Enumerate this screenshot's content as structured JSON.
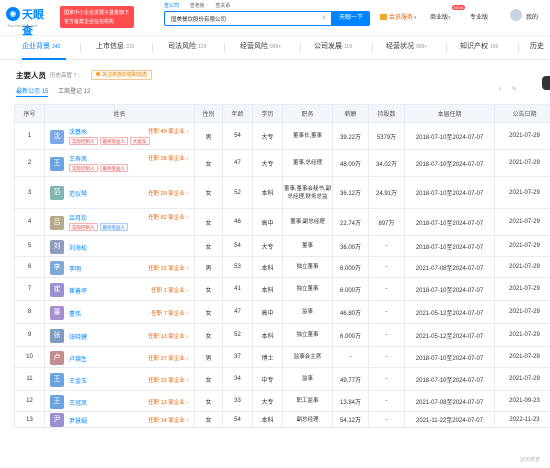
{
  "logo": {
    "name": "天眼查",
    "sub": "TianYanCha.com"
  },
  "promo": {
    "line1": "国家中小企业发展子基金旗下",
    "line2": "官方备案企业征信机构"
  },
  "search": {
    "tabs": [
      "查公司",
      "查老板",
      "查关系"
    ],
    "value": "国美餐饮股份有限公司",
    "button": "天眼一下"
  },
  "nav": {
    "vip": "会员服务",
    "business": "商业版",
    "business_badge": "NEW",
    "pro": "专业版",
    "me": "我的"
  },
  "section_tabs": [
    {
      "label": "企业背景",
      "count": "242"
    },
    {
      "label": "上市信息",
      "count": "315"
    },
    {
      "label": "司法风险",
      "count": "123"
    },
    {
      "label": "经营风险",
      "count": "999+"
    },
    {
      "label": "公司发展",
      "count": "119"
    },
    {
      "label": "经营状况",
      "count": "999+"
    },
    {
      "label": "知识产权",
      "count": "156"
    },
    {
      "label": "历史",
      "count": ""
    }
  ],
  "section": {
    "title": "主要人员",
    "history": "历史高管 7",
    "tag": "关注高管的任职动态",
    "sub_tabs": [
      "最新公示 15",
      "工商登记 12"
    ],
    "tools": [
      "导出",
      "纠错"
    ]
  },
  "table": {
    "headers": [
      "序号",
      "姓名",
      "性别",
      "年龄",
      "学历",
      "职务",
      "薪酬",
      "持股数",
      "本届任期",
      "公告日期"
    ],
    "rows": [
      {
        "no": "1",
        "avatar": "沈",
        "color": "#7ba7e8",
        "name": "沈基水",
        "info": "任职 40 家企业",
        "tags": [
          [
            "实际控制人",
            "red"
          ],
          [
            "最终受益人",
            "red"
          ],
          [
            "大股东",
            "red"
          ]
        ],
        "gender": "男",
        "age": "54",
        "edu": "大专",
        "pos": "董事长,董事",
        "pay": "39.22万",
        "shares": "5379万",
        "term": "2018-07-10至2024-07-07",
        "date": "2021-07-29"
      },
      {
        "no": "2",
        "avatar": "王",
        "color": "#6aa3e0",
        "name": "王寿凤",
        "info": "任职 28 家企业",
        "tags": [
          [
            "实际控制人",
            "red"
          ],
          [
            "最终受益人",
            "red"
          ]
        ],
        "gender": "女",
        "age": "47",
        "edu": "大专",
        "pos": "董事,总经理",
        "pay": "48.00万",
        "shares": "34.02万",
        "term": "2018-07-10至2024-07-07",
        "date": "2021-07-29"
      },
      {
        "no": "3",
        "avatar": "范",
        "color": "#7fb6b0",
        "name": "范仪琴",
        "info": "任职 29 家企业",
        "tags": [],
        "gender": "女",
        "age": "52",
        "edu": "本科",
        "pos": "董事,董事会秘书,副总经理,财务总监",
        "pay": "36.12万",
        "shares": "24.91万",
        "term": "2018-07-10至2024-07-07",
        "date": "2021-07-29"
      },
      {
        "no": "4",
        "avatar": "吕",
        "color": "#b9a98c",
        "name": "吕月珍",
        "info": "任职 82 家企业",
        "tags": [
          [
            "实际控制人",
            "red"
          ],
          [
            "最终受益人",
            "blue"
          ]
        ],
        "gender": "女",
        "age": "46",
        "edu": "高中",
        "pos": "董事,副总经理",
        "pay": "22.74万",
        "shares": "897万",
        "term": "2018-07-10至2024-07-07",
        "date": "2021-07-29"
      },
      {
        "no": "5",
        "avatar": "刘",
        "color": "#8e9dc0",
        "name": "刘海松",
        "info": "",
        "tags": [],
        "gender": "女",
        "age": "54",
        "edu": "大专",
        "pos": "董事",
        "pay": "36.00万",
        "shares": "-",
        "term": "2018-07-10至2024-07-07",
        "date": "2021-07-29"
      },
      {
        "no": "6",
        "avatar": "李",
        "color": "#7ea8d6",
        "name": "李明",
        "info": "任职 12 家企业",
        "tags": [],
        "gender": "男",
        "age": "53",
        "edu": "本科",
        "pos": "独立董事",
        "pay": "6.000万",
        "shares": "-",
        "term": "2021-07-08至2024-07-07",
        "date": "2021-07-29"
      },
      {
        "no": "7",
        "avatar": "崔",
        "color": "#9b8fd0",
        "name": "崔善坪",
        "info": "任职 1 家企业",
        "tags": [],
        "gender": "女",
        "age": "41",
        "edu": "本科",
        "pos": "独立董事",
        "pay": "6.000万",
        "shares": "-",
        "term": "2018-07-10至2024-07-07",
        "date": "2021-07-29"
      },
      {
        "no": "8",
        "avatar": "董",
        "color": "#a88fd0",
        "name": "董伟",
        "info": "任职 7 家企业",
        "tags": [],
        "gender": "女",
        "age": "47",
        "edu": "高中",
        "pos": "监事",
        "pay": "46.80万",
        "shares": "-",
        "term": "2021-05-12至2024-07-07",
        "date": "2021-07-29"
      },
      {
        "no": "9",
        "avatar": "张",
        "color": "#7e9bc4",
        "name": "张晓健",
        "info": "任职 13 家企业",
        "tags": [],
        "gender": "女",
        "age": "52",
        "edu": "本科",
        "pos": "独立董事",
        "pay": "6.000万",
        "shares": "-",
        "term": "2021-05-12至2024-07-07",
        "date": "2021-07-29"
      },
      {
        "no": "10",
        "avatar": "卢",
        "color": "#c48d8d",
        "name": "卢锦生",
        "info": "任职 27 家企业",
        "tags": [],
        "gender": "男",
        "age": "37",
        "edu": "博士",
        "pos": "监事会主席",
        "pay": "-",
        "shares": "-",
        "term": "2018-07-10至2024-07-07",
        "date": "2021-07-29"
      },
      {
        "no": "11",
        "avatar": "王",
        "color": "#6aa3e0",
        "name": "王金玉",
        "info": "任职 13 家企业",
        "tags": [],
        "gender": "女",
        "age": "34",
        "edu": "中专",
        "pos": "监事",
        "pay": "49.77万",
        "shares": "-",
        "term": "2018-07-10至2024-07-07",
        "date": "2021-07-29"
      },
      {
        "no": "12",
        "avatar": "王",
        "color": "#6aa3e0",
        "name": "王冠凤",
        "info": "任职 13 家企业",
        "tags": [],
        "gender": "女",
        "age": "33",
        "edu": "大专",
        "pos": "职工监事",
        "pay": "13.84万",
        "shares": "-",
        "term": "2021-07-08至2024-07-07",
        "date": "2021-09-23"
      },
      {
        "no": "13",
        "avatar": "尹",
        "color": "#9b8fd0",
        "name": "尹慧娟",
        "info": "任职 14 家企业",
        "tags": [],
        "gender": "女",
        "age": "54",
        "edu": "本科",
        "pos": "副总经理",
        "pay": "54.12万",
        "shares": "-",
        "term": "2021-11-22至2024-07-07",
        "date": "2022-11-23"
      }
    ]
  },
  "watermark": "@天眼查"
}
